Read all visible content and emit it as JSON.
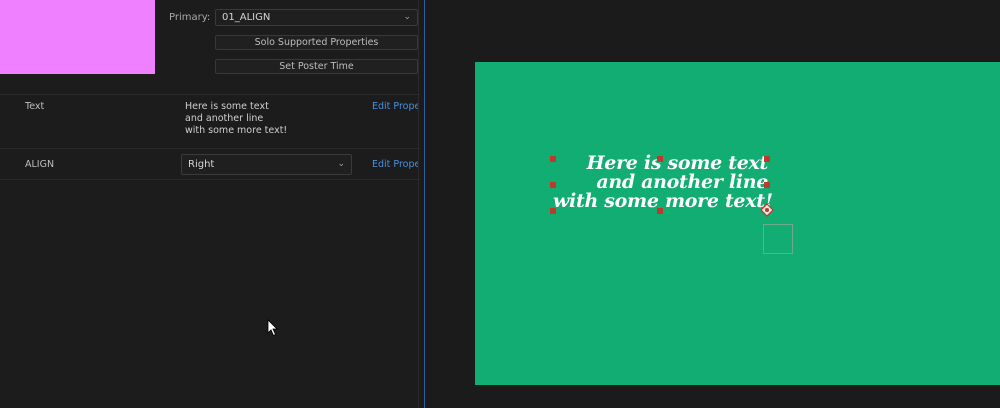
{
  "effect_controls": {
    "primary_label": "Primary:",
    "primary_value": "01_ALIGN",
    "solo_button": "Solo Supported Properties",
    "poster_button": "Set Poster Time",
    "properties": [
      {
        "name": "Text",
        "value_lines": [
          "Here is some text",
          "and another line",
          "with some more text!"
        ],
        "link": "Edit Prope"
      },
      {
        "name": "ALIGN",
        "value": "Right",
        "link": "Edit Prope"
      }
    ]
  },
  "program_monitor": {
    "text_lines": [
      "Here is some text",
      "and another line",
      "with some more text!"
    ]
  },
  "colors": {
    "thumbnail": "#ef80ff",
    "canvas": "#11ad72",
    "link": "#4a8fe0",
    "handle": "#c0392b"
  },
  "icons": [
    "chevron-down-icon",
    "mouse-cursor-icon",
    "anchor-point-icon"
  ]
}
